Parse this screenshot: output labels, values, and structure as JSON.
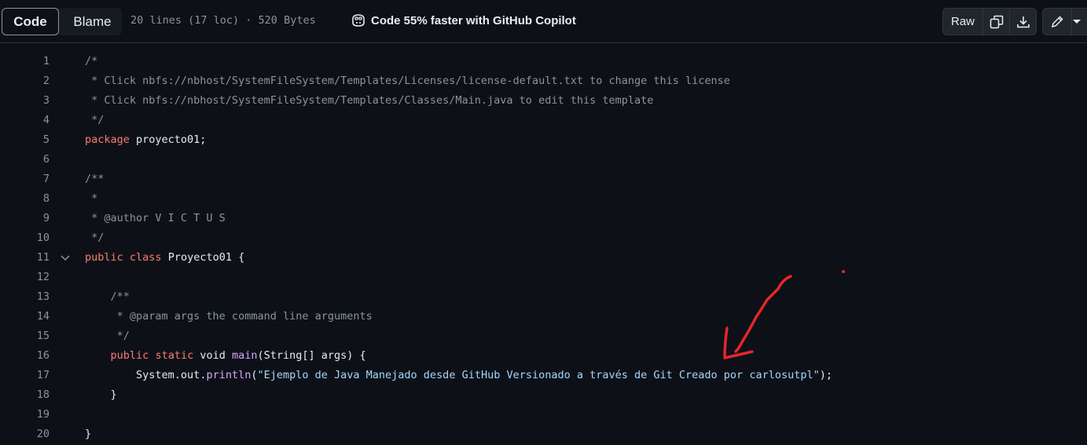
{
  "toolbar": {
    "code_tab": "Code",
    "blame_tab": "Blame",
    "file_info": "20 lines (17 loc) · 520 Bytes",
    "copilot_text": "Code 55% faster with GitHub Copilot",
    "raw_label": "Raw",
    "copy_icon": "copy-icon",
    "download_icon": "download-icon",
    "edit_icon": "pencil-icon",
    "more_icon": "triangle-down-icon"
  },
  "colors": {
    "background": "#0d1117",
    "comment": "#8b949e",
    "keyword": "#ff7b72",
    "function": "#d2a8ff",
    "string": "#a5d6ff",
    "annotation": "#e5262b"
  },
  "code": {
    "lines": [
      {
        "n": "1",
        "tokens": [
          {
            "t": "/*",
            "k": "c-com"
          }
        ]
      },
      {
        "n": "2",
        "tokens": [
          {
            "t": " * Click nbfs://nbhost/SystemFileSystem/Templates/Licenses/license-default.txt to change this license",
            "k": "c-com"
          }
        ]
      },
      {
        "n": "3",
        "tokens": [
          {
            "t": " * Click nbfs://nbhost/SystemFileSystem/Templates/Classes/Main.java to edit this template",
            "k": "c-com"
          }
        ]
      },
      {
        "n": "4",
        "tokens": [
          {
            "t": " */",
            "k": "c-com"
          }
        ]
      },
      {
        "n": "5",
        "tokens": [
          {
            "t": "package",
            "k": "c-kw"
          },
          {
            "t": " proyecto01;",
            "k": "c-pl"
          }
        ]
      },
      {
        "n": "6",
        "tokens": []
      },
      {
        "n": "7",
        "tokens": [
          {
            "t": "/**",
            "k": "c-com"
          }
        ]
      },
      {
        "n": "8",
        "tokens": [
          {
            "t": " *",
            "k": "c-com"
          }
        ]
      },
      {
        "n": "9",
        "tokens": [
          {
            "t": " * @author V I C T U S",
            "k": "c-com"
          }
        ]
      },
      {
        "n": "10",
        "tokens": [
          {
            "t": " */",
            "k": "c-com"
          }
        ]
      },
      {
        "n": "11",
        "fold": true,
        "tokens": [
          {
            "t": "public",
            "k": "c-kw"
          },
          {
            "t": " ",
            "k": "c-pl"
          },
          {
            "t": "class",
            "k": "c-kw"
          },
          {
            "t": " Proyecto01 {",
            "k": "c-pl"
          }
        ]
      },
      {
        "n": "12",
        "tokens": []
      },
      {
        "n": "13",
        "tokens": [
          {
            "t": "    /**",
            "k": "c-com"
          }
        ]
      },
      {
        "n": "14",
        "tokens": [
          {
            "t": "     * @param args the command line arguments",
            "k": "c-com"
          }
        ]
      },
      {
        "n": "15",
        "tokens": [
          {
            "t": "     */",
            "k": "c-com"
          }
        ]
      },
      {
        "n": "16",
        "tokens": [
          {
            "t": "    ",
            "k": "c-pl"
          },
          {
            "t": "public",
            "k": "c-kw"
          },
          {
            "t": " ",
            "k": "c-pl"
          },
          {
            "t": "static",
            "k": "c-kw"
          },
          {
            "t": " void ",
            "k": "c-pl"
          },
          {
            "t": "main",
            "k": "c-fn"
          },
          {
            "t": "(String[] args) {",
            "k": "c-pl"
          }
        ]
      },
      {
        "n": "17",
        "tokens": [
          {
            "t": "        System.out.",
            "k": "c-pl"
          },
          {
            "t": "println",
            "k": "c-fn"
          },
          {
            "t": "(",
            "k": "c-pl"
          },
          {
            "t": "\"Ejemplo de Java Manejado desde GitHub Versionado a través de Git Creado por carlosutpl\"",
            "k": "c-str"
          },
          {
            "t": ");",
            "k": "c-pl"
          }
        ]
      },
      {
        "n": "18",
        "tokens": [
          {
            "t": "    }",
            "k": "c-pl"
          }
        ]
      },
      {
        "n": "19",
        "tokens": []
      },
      {
        "n": "20",
        "tokens": [
          {
            "t": "}",
            "k": "c-pl"
          }
        ]
      }
    ]
  }
}
